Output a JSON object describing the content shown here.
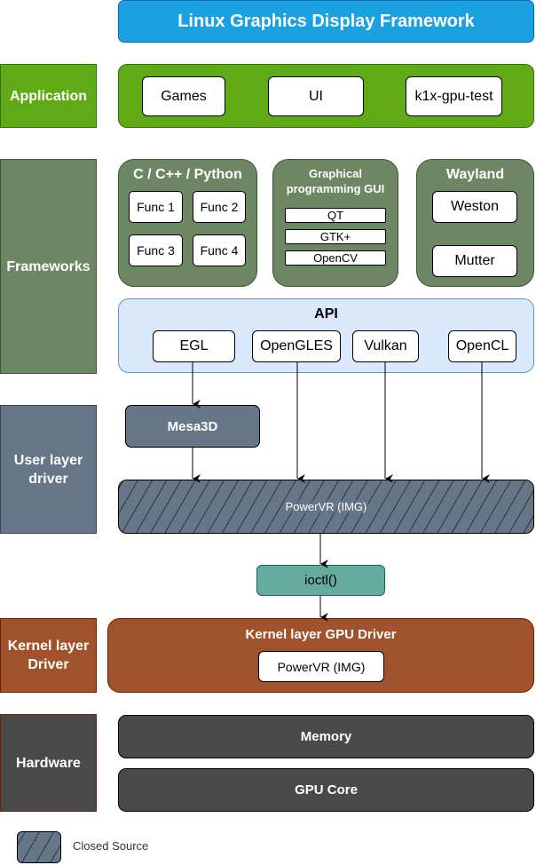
{
  "title": "Linux Graphics Display Framework",
  "layers": {
    "application": "Application",
    "frameworks": "Frameworks",
    "user_driver": "User layer driver",
    "kernel_driver": "Kernel layer Driver",
    "hardware": "Hardware"
  },
  "application": {
    "items": [
      "Games",
      "UI",
      "k1x-gpu-test"
    ]
  },
  "frameworks": {
    "lang": {
      "title": "C / C++ / Python",
      "items": [
        "Func 1",
        "Func 2",
        "Func 3",
        "Func 4"
      ]
    },
    "gui": {
      "title": "Graphical programming GUI",
      "items": [
        "QT",
        "GTK+",
        "OpenCV"
      ]
    },
    "wayland": {
      "title": "Wayland",
      "items": [
        "Weston",
        "Mutter"
      ]
    }
  },
  "api": {
    "title": "API",
    "items": [
      "EGL",
      "OpenGLES",
      "Vulkan",
      "OpenCL"
    ]
  },
  "user_driver": {
    "mesa": "Mesa3D",
    "powervr": "PowerVR (IMG)"
  },
  "ioctl": "ioctl()",
  "kernel": {
    "title": "Kernel layer GPU Driver",
    "powervr": "PowerVR (IMG)"
  },
  "hardware": {
    "memory": "Memory",
    "gpu": "GPU Core"
  },
  "legend": {
    "closed_source": "Closed Source"
  }
}
